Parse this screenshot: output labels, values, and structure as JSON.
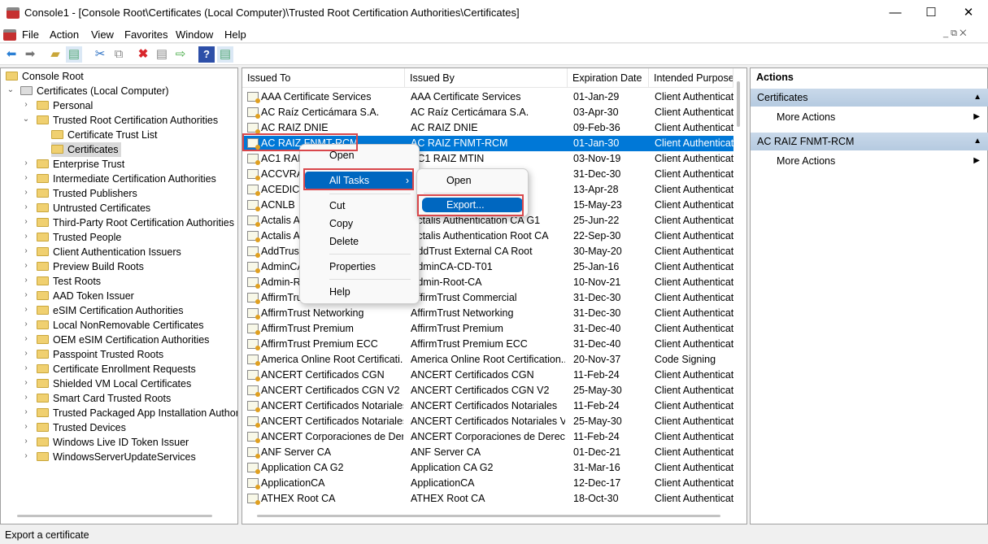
{
  "window": {
    "title": "Console1 - [Console Root\\Certificates (Local Computer)\\Trusted Root Certification Authorities\\Certificates]",
    "minimize": "—",
    "maximize": "☐",
    "close": "✕"
  },
  "menubar": [
    "File",
    "Action",
    "View",
    "Favorites",
    "Window",
    "Help"
  ],
  "toolbar": {
    "icons": [
      "back-icon",
      "forward-icon",
      "up-folder-icon",
      "show-hide-tree-icon",
      "cut-icon",
      "copy-icon",
      "delete-icon",
      "properties-icon",
      "export-list-icon",
      "help-icon",
      "show-hide-action-pane-icon"
    ]
  },
  "tree": {
    "root": "Console Root",
    "computer": "Certificates (Local Computer)",
    "items": [
      "Personal",
      "Trusted Root Certification Authorities",
      "Enterprise Trust",
      "Intermediate Certification Authorities",
      "Trusted Publishers",
      "Untrusted Certificates",
      "Third-Party Root Certification Authorities",
      "Trusted People",
      "Client Authentication Issuers",
      "Preview Build Roots",
      "Test Roots",
      "AAD Token Issuer",
      "eSIM Certification Authorities",
      "Local NonRemovable Certificates",
      "OEM eSIM Certification Authorities",
      "Passpoint Trusted Roots",
      "Certificate Enrollment Requests",
      "Shielded VM Local Certificates",
      "Smart Card Trusted Roots",
      "Trusted Packaged App Installation Authorit",
      "Trusted Devices",
      "Windows Live ID Token Issuer",
      "WindowsServerUpdateServices"
    ],
    "trusted_root_children": [
      "Certificate Trust List",
      "Certificates"
    ]
  },
  "list": {
    "columns": [
      "Issued To",
      "Issued By",
      "Expiration Date",
      "Intended Purposes"
    ],
    "rows": [
      [
        "AAA Certificate Services",
        "AAA Certificate Services",
        "01-Jan-29",
        "Client Authentication"
      ],
      [
        "AC Raíz Certicámara S.A.",
        "AC Raíz Certicámara S.A.",
        "03-Apr-30",
        "Client Authentication"
      ],
      [
        "AC RAIZ DNIE",
        "AC RAIZ DNIE",
        "09-Feb-36",
        "Client Authentication"
      ],
      [
        "AC RAIZ FNMT-RCM",
        "AC RAIZ FNMT-RCM",
        "01-Jan-30",
        "Client Authentication"
      ],
      [
        "AC1 RAIZ MTIN",
        "AC1 RAIZ MTIN",
        "03-Nov-19",
        "Client Authentication"
      ],
      [
        "ACCVRAIZ1",
        "ACCVRAIZ1",
        "31-Dec-30",
        "Client Authentication"
      ],
      [
        "ACEDICOM Root",
        "ACEDICOM Root",
        "13-Apr-28",
        "Client Authentication"
      ],
      [
        "ACNLB",
        "ACNLB",
        "15-May-23",
        "Client Authentication"
      ],
      [
        "Actalis Authentication CA G1",
        "Actalis Authentication CA G1",
        "25-Jun-22",
        "Client Authentication"
      ],
      [
        "Actalis Authentication Root CA",
        "Actalis Authentication Root CA",
        "22-Sep-30",
        "Client Authentication"
      ],
      [
        "AddTrust External CA Root",
        "AddTrust External CA Root",
        "30-May-20",
        "Client Authentication"
      ],
      [
        "AdminCA-CD-T01",
        "AdminCA-CD-T01",
        "25-Jan-16",
        "Client Authentication"
      ],
      [
        "Admin-Root-CA",
        "Admin-Root-CA",
        "10-Nov-21",
        "Client Authentication"
      ],
      [
        "AffirmTrust Commercial",
        "AffirmTrust Commercial",
        "31-Dec-30",
        "Client Authentication"
      ],
      [
        "AffirmTrust Networking",
        "AffirmTrust Networking",
        "31-Dec-30",
        "Client Authentication"
      ],
      [
        "AffirmTrust Premium",
        "AffirmTrust Premium",
        "31-Dec-40",
        "Client Authentication"
      ],
      [
        "AffirmTrust Premium ECC",
        "AffirmTrust Premium ECC",
        "31-Dec-40",
        "Client Authentication"
      ],
      [
        "America Online Root Certificati...",
        "America Online Root Certification...",
        "20-Nov-37",
        "Code Signing"
      ],
      [
        "ANCERT Certificados CGN",
        "ANCERT Certificados CGN",
        "11-Feb-24",
        "Client Authentication"
      ],
      [
        "ANCERT Certificados CGN V2",
        "ANCERT Certificados CGN V2",
        "25-May-30",
        "Client Authentication"
      ],
      [
        "ANCERT Certificados Notariales",
        "ANCERT Certificados Notariales",
        "11-Feb-24",
        "Client Authentication"
      ],
      [
        "ANCERT Certificados Notariales...",
        "ANCERT Certificados Notariales V2",
        "25-May-30",
        "Client Authentication"
      ],
      [
        "ANCERT Corporaciones de Dere...",
        "ANCERT Corporaciones de Derech...",
        "11-Feb-24",
        "Client Authentication"
      ],
      [
        "ANF Server CA",
        "ANF Server CA",
        "01-Dec-21",
        "Client Authentication"
      ],
      [
        "Application CA G2",
        "Application CA G2",
        "31-Mar-16",
        "Client Authentication"
      ],
      [
        "ApplicationCA",
        "ApplicationCA",
        "12-Dec-17",
        "Client Authentication"
      ],
      [
        "ATHEX Root CA",
        "ATHEX Root CA",
        "18-Oct-30",
        "Client Authentication"
      ]
    ],
    "selected_index": 3
  },
  "context_menu": {
    "items": [
      "Open",
      "All Tasks",
      "Cut",
      "Copy",
      "Delete",
      "Properties",
      "Help"
    ],
    "submenu": [
      "Open",
      "Export..."
    ]
  },
  "actions": {
    "title": "Actions",
    "sections": [
      {
        "header": "Certificates",
        "item": "More Actions"
      },
      {
        "header": "AC RAIZ FNMT-RCM",
        "item": "More Actions"
      }
    ]
  },
  "status": "Export a certificate",
  "colors": {
    "selection": "#0078d7",
    "highlight_box": "#d9474b",
    "actions_header": "#c2d4e8"
  }
}
